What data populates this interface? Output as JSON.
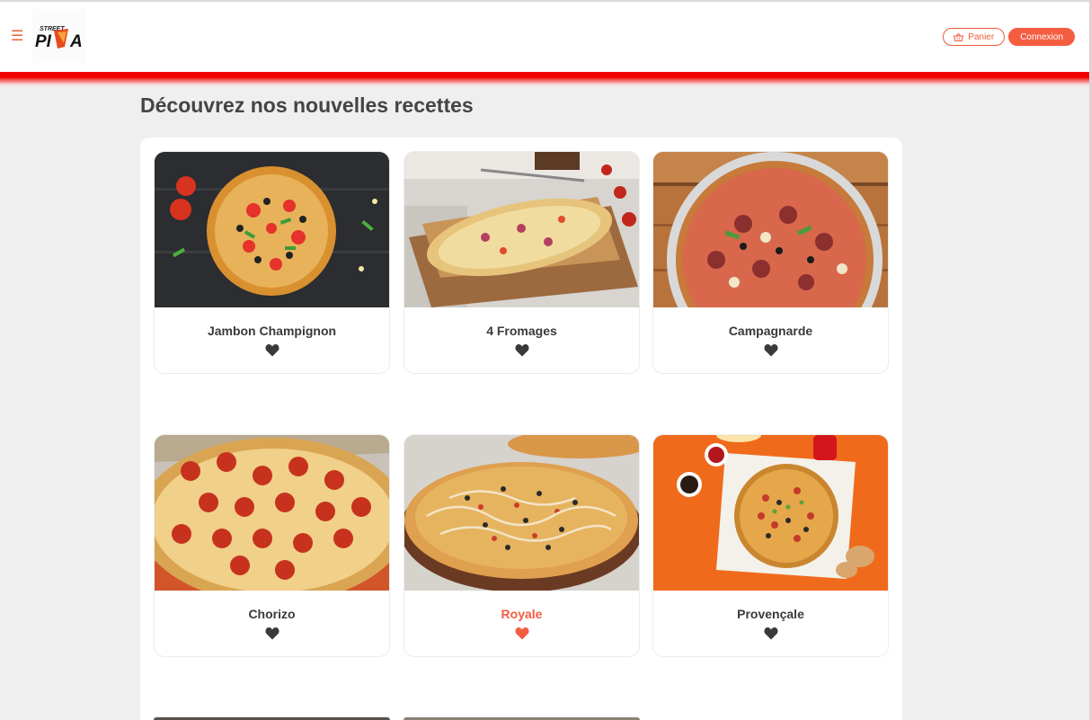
{
  "header": {
    "menu_icon": "hamburger-menu-icon",
    "logo_text_top": "STREET",
    "logo_text_main": "PIZZA",
    "cart_label": "Panier",
    "cart_icon": "basket-icon",
    "login_label": "Connexion"
  },
  "main": {
    "title": "Découvrez nos nouvelles recettes"
  },
  "recipes": [
    {
      "name": "Jambon Champignon",
      "favorite": false
    },
    {
      "name": "4 Fromages",
      "favorite": false
    },
    {
      "name": "Campagnarde",
      "favorite": false
    },
    {
      "name": "Chorizo",
      "favorite": false
    },
    {
      "name": "Royale",
      "favorite": true
    },
    {
      "name": "Provençale",
      "favorite": false
    }
  ],
  "colors": {
    "accent": "#f55d41",
    "header_bar": "#f00000",
    "heart_default": "#3a3a3a",
    "background": "#efefef"
  }
}
